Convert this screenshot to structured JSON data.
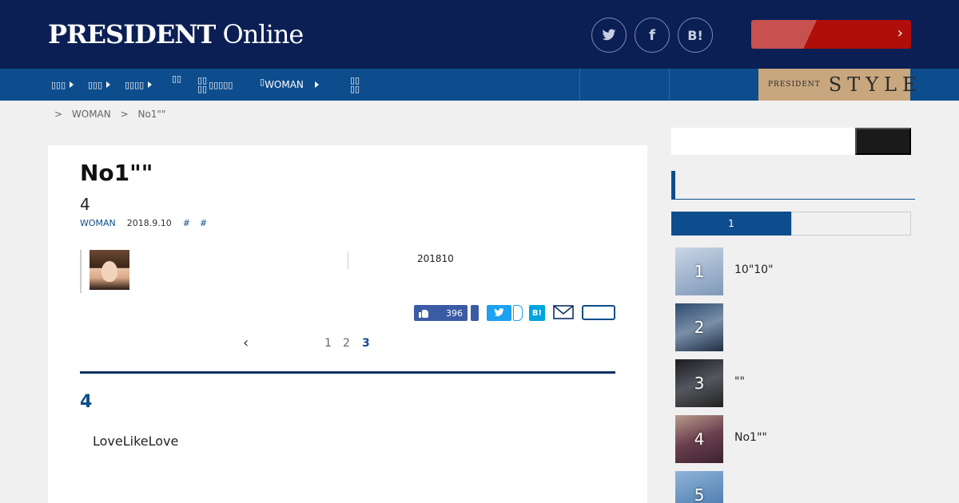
{
  "header": {
    "logo_bold": "PRESIDENT",
    "logo_light": "Online",
    "social": [
      {
        "icon": "twitter-icon",
        "glyph": "🐦︎"
      },
      {
        "icon": "facebook-icon",
        "glyph": "f"
      },
      {
        "icon": "hatena-icon",
        "glyph": "B!"
      }
    ],
    "cta_chevron": "›"
  },
  "nav": {
    "woman_label": "WOMAN",
    "style_small": "PRESIDENT",
    "style_big": "STYLE"
  },
  "breadcrumb": {
    "sep": ">",
    "items": [
      "WOMAN",
      "No1\"\""
    ]
  },
  "article": {
    "title": "No1\"\"",
    "subtitle": "4",
    "category": "WOMAN",
    "date": "2018.9.10",
    "tags": [
      "#",
      "#"
    ],
    "pub_note": "201810",
    "like_count": "396",
    "hatena_label": "B!",
    "pager": {
      "prev": "‹",
      "pages": [
        "1",
        "2",
        "3"
      ],
      "current": "3"
    },
    "section_heading": "4",
    "body": "LoveLikeLove"
  },
  "sidebar": {
    "tab_active": "1",
    "ranking": [
      {
        "rank": "1",
        "title": "10\"10\"",
        "bg": "#8fa6c3"
      },
      {
        "rank": "2",
        "title": "",
        "bg": "#3d5f86"
      },
      {
        "rank": "3",
        "title": "\"\"",
        "bg": "#2f2f33"
      },
      {
        "rank": "4",
        "title": "No1\"\"",
        "bg": "#7b5a63"
      },
      {
        "rank": "5",
        "title": "",
        "bg": "#4d7fb0"
      }
    ]
  },
  "colors": {
    "header_bg": "#0b1f55",
    "nav_bg": "#0e4d8d",
    "cta": "#b00e0a",
    "style_badge": "#c8a77e"
  }
}
